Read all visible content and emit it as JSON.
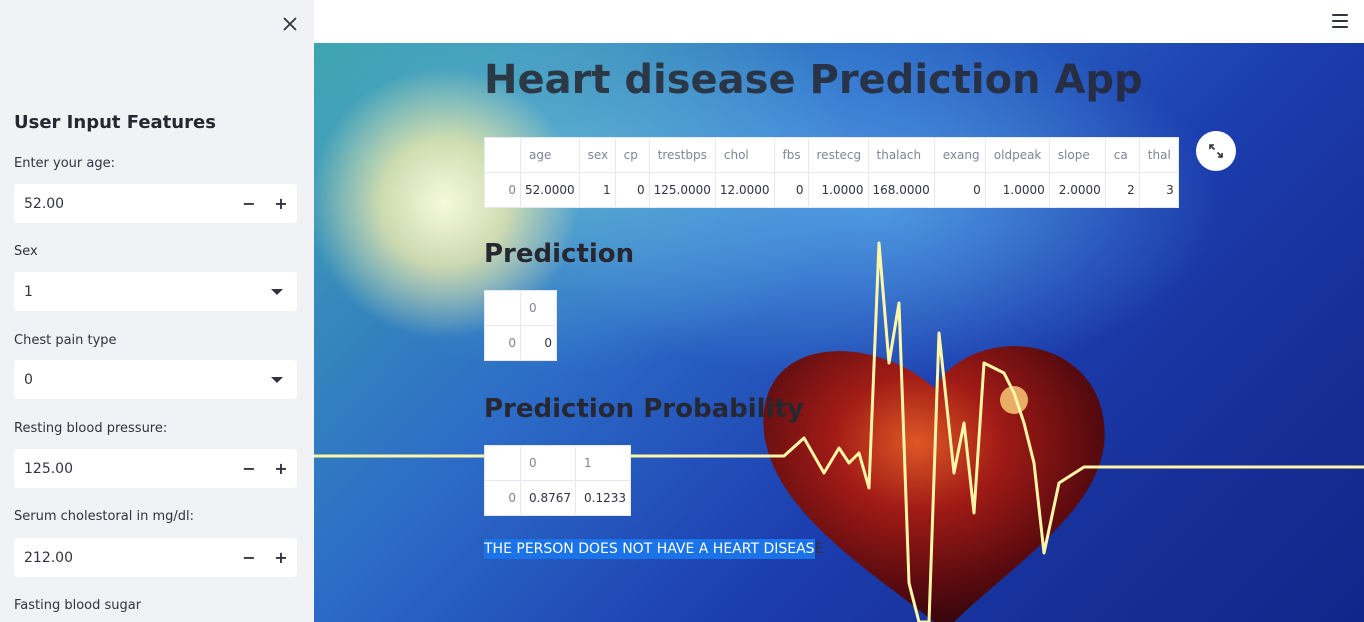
{
  "sidebar": {
    "title": "User Input Features",
    "fields": [
      {
        "label": "Enter your age:",
        "value": "52.00",
        "type": "number"
      },
      {
        "label": "Sex",
        "value": "1",
        "type": "select"
      },
      {
        "label": "Chest pain type",
        "value": "0",
        "type": "select"
      },
      {
        "label": "Resting blood pressure:",
        "value": "125.00",
        "type": "number"
      },
      {
        "label": "Serum cholestoral in mg/dl:",
        "value": "212.00",
        "type": "number"
      },
      {
        "label": "Fasting blood sugar",
        "value": "",
        "type": "label"
      }
    ],
    "minus": "−",
    "plus": "+"
  },
  "main": {
    "title": "Heart disease Prediction App",
    "input_table": {
      "columns": [
        "",
        "age",
        "sex",
        "cp",
        "trestbps",
        "chol",
        "fbs",
        "restecg",
        "thalach",
        "exang",
        "oldpeak",
        "slope",
        "ca",
        "thal"
      ],
      "rows": [
        [
          "0",
          "52.0000",
          "1",
          "0",
          "125.0000",
          "12.0000",
          "0",
          "1.0000",
          "168.0000",
          "0",
          "1.0000",
          "2.0000",
          "2",
          "3"
        ]
      ]
    },
    "prediction_heading": "Prediction",
    "prediction_table": {
      "columns": [
        "",
        "0"
      ],
      "rows": [
        [
          "0",
          "0"
        ]
      ]
    },
    "probability_heading": "Prediction Probability",
    "probability_table": {
      "columns": [
        "",
        "0",
        "1"
      ],
      "rows": [
        [
          "0",
          "0.8767",
          "0.1233"
        ]
      ]
    },
    "result_highlighted": "THE PERSON DOES NOT HAVE A HEART DISEAS",
    "result_rest": "E"
  }
}
